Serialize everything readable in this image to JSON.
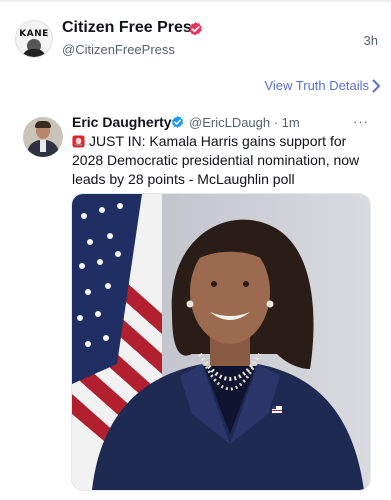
{
  "post": {
    "author_name": "Citizen Free Press",
    "author_handle": "@CitizenFreePress",
    "avatar_text": "KANE",
    "time_ago": "3h",
    "view_details": "View Truth Details"
  },
  "quoted": {
    "author_name": "Eric Daugherty",
    "author_handle_time": "@EricLDaugh · 1m",
    "more": "···",
    "text": "JUST IN: Kamala Harris gains support for 2028 Democratic presidential nomination, now leads by 28 points - McLaughlin poll"
  },
  "colors": {
    "link": "#5b6fd1",
    "verified_pink": "#e8355c",
    "verified_blue": "#1d9bf0"
  },
  "icons": [
    "verified-badge-icon",
    "chevron-right-icon",
    "siren-icon",
    "more-icon"
  ]
}
